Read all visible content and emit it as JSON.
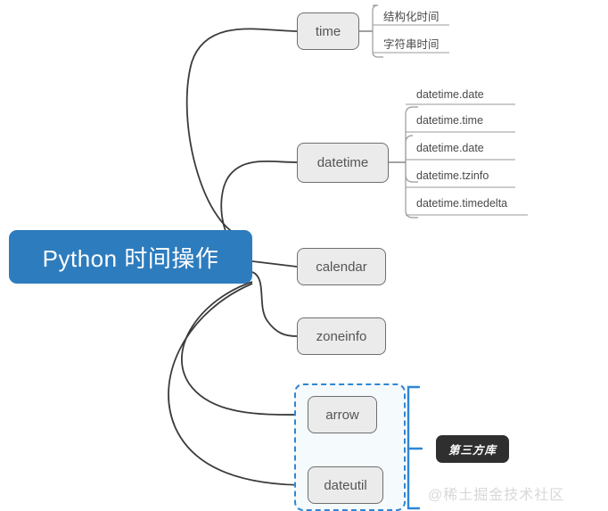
{
  "diagram": {
    "title": "Python 时间操作",
    "root": {
      "label": "Python 时间操作",
      "color": "#2d7cbe",
      "text_color": "#ffffff"
    },
    "branches": [
      {
        "id": "time",
        "label": "time",
        "children": [
          "结构化时间",
          "字符串时间"
        ]
      },
      {
        "id": "datetime",
        "label": "datetime",
        "children": [
          "datetime.date",
          "datetime.time",
          "datetime.date",
          "datetime.tzinfo",
          "datetime.timedelta"
        ]
      },
      {
        "id": "calendar",
        "label": "calendar",
        "children": []
      },
      {
        "id": "zoneinfo",
        "label": "zoneinfo",
        "children": []
      },
      {
        "id": "arrow",
        "label": "arrow",
        "children": []
      },
      {
        "id": "dateutil",
        "label": "dateutil",
        "children": []
      }
    ],
    "group": {
      "label": "第三方库",
      "members": [
        "arrow",
        "dateutil"
      ],
      "border_color": "#2f86d4",
      "badge_bg": "#2f2f2f",
      "badge_text_color": "#ffffff"
    },
    "node_style": {
      "fill": "#ebebeb",
      "border": "#6e6e6e",
      "text": "#555555"
    },
    "edge_color": "#3b3b3b",
    "leaf_text_color": "#4a4a4a",
    "watermark": "@稀土掘金技术社区"
  }
}
